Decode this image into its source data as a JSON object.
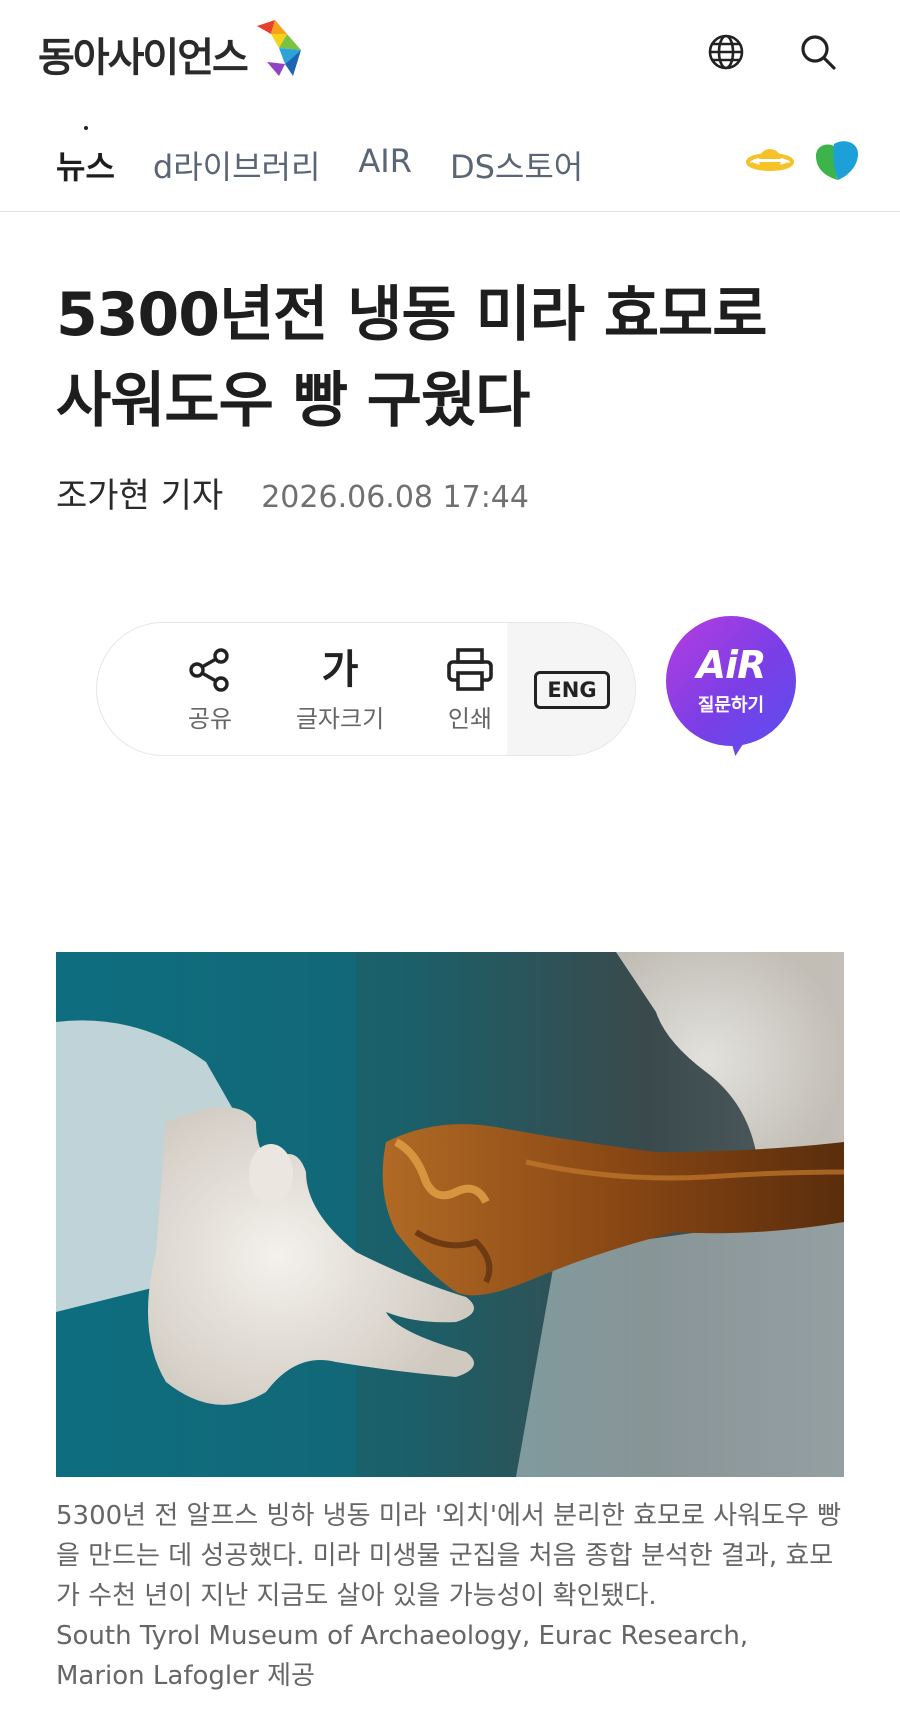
{
  "header": {
    "logo_text": "동아사이언스",
    "globe_icon": "globe-icon",
    "search_icon": "search-icon"
  },
  "nav": {
    "items": [
      {
        "label": "뉴스",
        "active": true
      },
      {
        "label": "d라이브러리",
        "active": false
      },
      {
        "label": "AIR",
        "active": false
      },
      {
        "label": "DS스토어",
        "active": false
      }
    ],
    "right_icons": [
      "planet-icon",
      "leaf-icon"
    ]
  },
  "article": {
    "title_line1": "5300년전 냉동 미라 효모로",
    "title_line2": "사워도우 빵 구웠다",
    "author": "조가현 기자",
    "date": "2026.06.08 17:44"
  },
  "toolbar": {
    "share_label": "공유",
    "fontsize_glyph": "가",
    "fontsize_label": "글자크기",
    "print_label": "인쇄",
    "eng_label": "ENG"
  },
  "air": {
    "logo": "AiR",
    "label": "질문하기"
  },
  "caption": {
    "text": "5300년 전 알프스 빙하 냉동 미라 '외치'에서 분리한 효모로 사워도우 빵을 만드는 데 성공했다. 미라 미생물 군집을 처음 종합 분석한 결과, 효모가 수천 년이 지난 지금도 살아 있을 가능성이 확인됐다.",
    "credit_line1": "South Tyrol Museum of Archaeology, Eurac Research,",
    "credit_line2": "Marion Lafogler 제공"
  },
  "colors": {
    "accent_purple": "#7b3ee6",
    "text_dark": "#1e1e1e",
    "nav_gray": "#5a6575"
  }
}
